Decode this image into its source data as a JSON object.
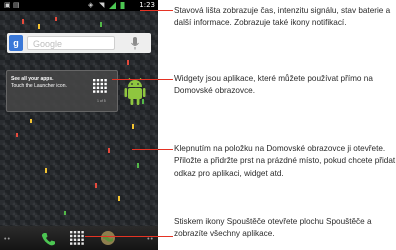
{
  "status_bar": {
    "time": "1:23",
    "icons": [
      "notification-icon",
      "media-icon",
      "gps-icon",
      "wifi-icon",
      "signal-icon",
      "battery-icon"
    ]
  },
  "search_widget": {
    "placeholder": "Google",
    "logo_letter": "g"
  },
  "launcher_widget": {
    "title": "See all your apps.",
    "description": "Touch the Launcher icon.",
    "pager": "1 of 5"
  },
  "dock": {
    "left_dots": "••",
    "right_dots": "••",
    "buttons": [
      "phone-icon",
      "launcher-icon",
      "browser-icon"
    ]
  },
  "callouts": [
    "Stavová lišta zobrazuje čas, intenzitu signálu, stav baterie a další informace. Zobrazuje také ikony notifikací.",
    "Widgety jsou aplikace, které můžete používat přímo na Domovské obrazovce.",
    "Klepnutím na položku na Domovské obrazovce ji otevřete. Přiložte a přidržte prst na prázdné místo, pokud chcete přidat odkaz pro aplikaci, widget atd.",
    "Stiskem ikony Spouštěče otevřete plochu Spouštěče a zobrazíte všechny aplikace."
  ],
  "colors": {
    "leader_line": "#e53324",
    "text": "#2b2b2b",
    "google_blue": "#3a78d8",
    "android_green": "#8fc63f"
  }
}
